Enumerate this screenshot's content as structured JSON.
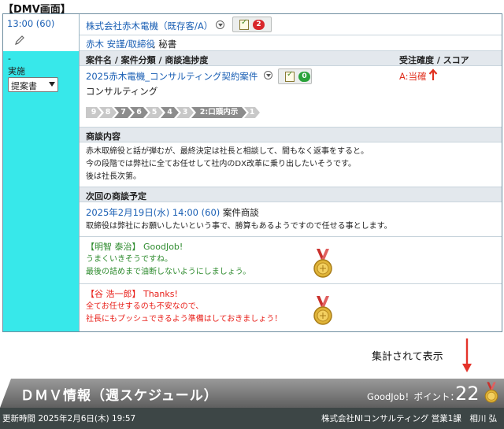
{
  "page_label": "【DMV画面】",
  "left": {
    "time": "13:00 (60)",
    "dash": "-",
    "status": "実施",
    "select_value": "提案書"
  },
  "visit": {
    "company": "株式会社赤木電機（既存客/A）",
    "memo_count": "2",
    "person_link": "赤木 安謹/取締役",
    "person_rest": ", 秘書"
  },
  "deal": {
    "header_left": "案件名 / 案件分類 / 商談進捗度",
    "header_right": "受注確度 / スコア",
    "name": "2025赤木電機_コンサルティング契約案件",
    "memo_count": "0",
    "type": "コンサルティング",
    "order_status": "A:当確",
    "stages": [
      "9",
      "8",
      "7",
      "6",
      "5",
      "4",
      "3",
      "2:口頭内示",
      "1"
    ]
  },
  "content": {
    "header": "商談内容",
    "lines": [
      "赤木取締役と話が弾むが、最終決定は社長と相談して、間もなく返事をすると。",
      "今の段階では弊社に全てお任せして社内のDX改革に乗り出したいそうです。",
      "後は社長次第。"
    ]
  },
  "next": {
    "header": "次回の商談予定",
    "datetime": "2025年2月19日(水) 14:00 (60)",
    "kind": " 案件商談",
    "note": "取締役は弊社にお願いしたいという事で、勝算もあるようですので任せる事とします。"
  },
  "praises": [
    {
      "title": "【明智 泰治】 GoodJob!",
      "lines": [
        "うまくいきそうですね。",
        "最後の詰めまで油断しないようにしましょう。"
      ],
      "color": "#2e8b2e"
    },
    {
      "title": "【谷 浩一郎】 Thanks!",
      "lines": [
        "全てお任せするのも不安なので、",
        "社長にもプッシュできるよう準備はしておきましょう！"
      ],
      "color": "#e8201a"
    }
  ],
  "annotation": "集計されて表示",
  "header_bar": {
    "title": "ＤＭＶ情報（週スケジュール）",
    "points_label": "GoodJob！ポイント：",
    "points": "22",
    "updated": "更新時間 2025年2月6日(木) 19:57",
    "org": "株式会社NIコンサルティング 営業1課　相川 弘"
  },
  "colors": {
    "accent_cyan": "#37e8ea",
    "link": "#1a5fb4",
    "badge_red": "#d8262a",
    "badge_green": "#2aa23a",
    "alert_red": "#e0301e"
  },
  "icons": [
    "pencil-icon",
    "memo-check-icon",
    "dropdown-circle-icon",
    "up-arrow-icon",
    "medal-icon"
  ]
}
